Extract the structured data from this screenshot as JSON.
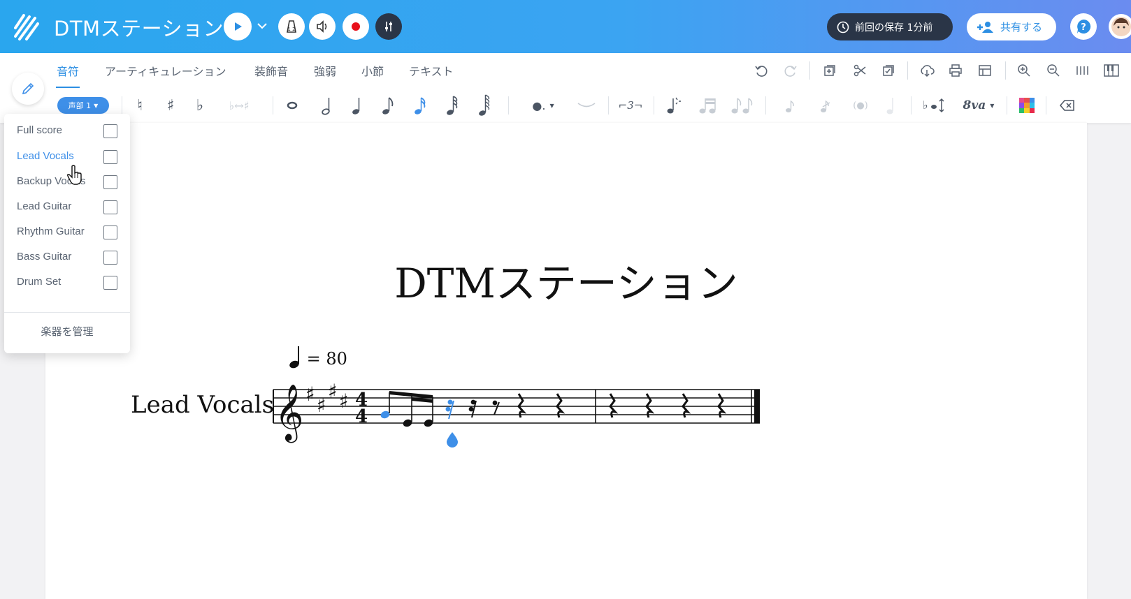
{
  "header": {
    "app_title": "DTMステーション",
    "saved_status": "前回の保存 1分前",
    "share_label": "共有する"
  },
  "tabs": [
    {
      "label": "音符",
      "active": true
    },
    {
      "label": "アーティキュレーション",
      "active": false
    },
    {
      "label": "装飾音",
      "active": false
    },
    {
      "label": "強弱",
      "active": false
    },
    {
      "label": "小節",
      "active": false
    },
    {
      "label": "テキスト",
      "active": false
    }
  ],
  "toolbar": {
    "voice_label": "声部 1",
    "transpose_octave_label": "8va"
  },
  "instrument_menu": {
    "items": [
      {
        "label": "Full score",
        "checked": false,
        "hovered": false
      },
      {
        "label": "Lead Vocals",
        "checked": false,
        "hovered": true
      },
      {
        "label": "Backup Vocals",
        "checked": false,
        "hovered": false
      },
      {
        "label": "Lead Guitar",
        "checked": false,
        "hovered": false
      },
      {
        "label": "Rhythm Guitar",
        "checked": false,
        "hovered": false
      },
      {
        "label": "Bass Guitar",
        "checked": false,
        "hovered": false
      },
      {
        "label": "Drum Set",
        "checked": false,
        "hovered": false
      }
    ],
    "manage_label": "楽器を管理"
  },
  "score": {
    "title": "DTMステーション",
    "tempo_value": "= 80",
    "part_name": "Lead Vocals",
    "time_signature": "4/4",
    "key_sharps": 4
  },
  "colors": {
    "accent": "#3e8fe8",
    "header_start": "#2aa6ee",
    "header_end": "#6b8cf0",
    "saved_pill": "#2a3547"
  }
}
